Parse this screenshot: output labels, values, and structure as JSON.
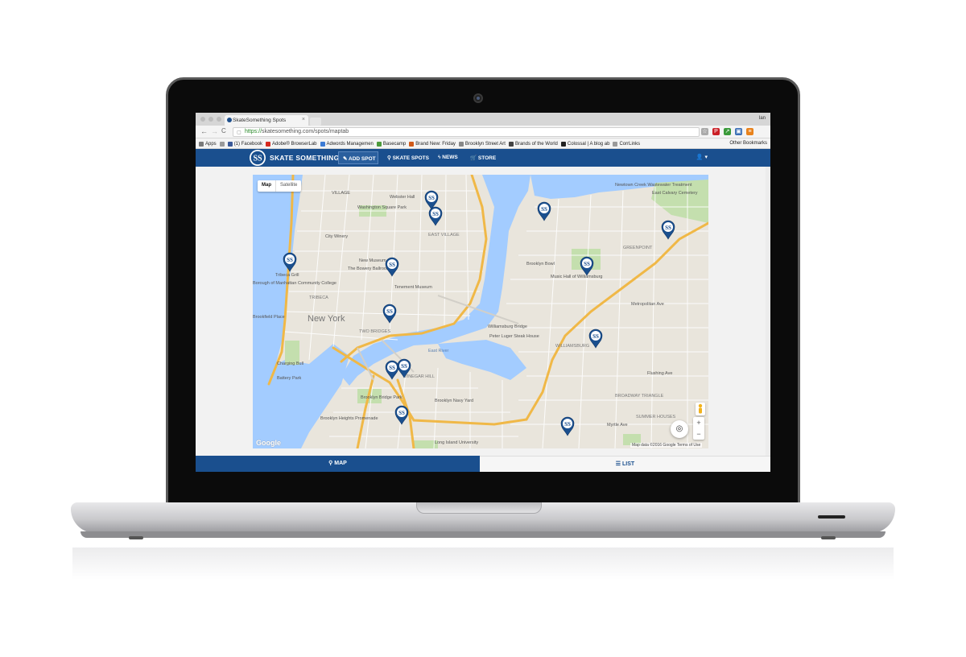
{
  "browser": {
    "tab_title": "SkateSomething Spots",
    "tab_close": "×",
    "user": "Ian",
    "url_scheme": "https://",
    "url_rest": "skatesomething.com/spots/maptab",
    "back": "←",
    "forward": "→",
    "reload": "C",
    "bookmarks": [
      {
        "label": "Apps",
        "color": "#7a7a7a"
      },
      {
        "label": "",
        "color": "#9a9a9a"
      },
      {
        "label": "(1) Facebook",
        "color": "#3b5998"
      },
      {
        "label": "Adobe® BrowserLab",
        "color": "#d62a1e"
      },
      {
        "label": "Adwords Managemen",
        "color": "#3c7bd4"
      },
      {
        "label": "Basecamp",
        "color": "#4c9a3c"
      },
      {
        "label": "Brand New: Friday",
        "color": "#d05a1a"
      },
      {
        "label": "Brooklyn Street Art",
        "color": "#888888"
      },
      {
        "label": "Brands of the World",
        "color": "#444444"
      },
      {
        "label": "Colossal | A blog ab",
        "color": "#222222"
      },
      {
        "label": "CorrLinks",
        "color": "#9a9a9a"
      }
    ],
    "other_bookmarks": "Other Bookmarks"
  },
  "site": {
    "logo_monogram": "SS",
    "logo_text": "SKATE SOMETHING",
    "add_spot": "✎ ADD SPOT",
    "nav": [
      {
        "label": "⚲ SKATE SPOTS"
      },
      {
        "label": "ϟ NEWS"
      },
      {
        "label": "🛒 STORE"
      }
    ],
    "user_menu": "👤 ▾"
  },
  "map": {
    "toggle_map": "Map",
    "toggle_satellite": "Satellite",
    "zoom_in": "+",
    "zoom_out": "−",
    "locate": "◎",
    "google": "Google",
    "attribution": "Map data ©2016 Google    Terms of Use",
    "labels": {
      "village": "VILLAGE",
      "webster": "Webster Hall",
      "washington": "Washington Square Park",
      "east_village": "EAST VILLAGE",
      "city_winery": "City Winery",
      "new_museum": "New Museum",
      "bowery": "The Bowery Ballroom",
      "tenement": "Tenement Museum",
      "tribeca_grill": "Tribeca Grill",
      "bmcc": "Borough of Manhattan Community College",
      "tribeca": "TRIBECA",
      "new_york": "New York",
      "two_bridges": "TWO BRIDGES",
      "brookfield": "Brookfield Place",
      "charging_bull": "Charging Bull",
      "battery": "Battery Park",
      "brooklyn_bridge_park": "Brooklyn Bridge Park",
      "heights": "Brooklyn Heights Promenade",
      "vinegar_hill": "VINEGAR HILL",
      "navy_yard": "Brooklyn Navy Yard",
      "liu": "Long Island University",
      "east_river": "East River",
      "williamsburg": "WILLIAMSBURG",
      "greenpoint": "GREENPOINT",
      "brooklyn_bowl": "Brooklyn Bowl",
      "music_hall": "Music Hall of Williamsburg",
      "peter_luger": "Peter Luger Steak House",
      "newtown": "Newtown Creek Wastewater Treatment",
      "calvary": "East Calvary Cemetery",
      "broadway_triangle": "BROADWAY TRIANGLE",
      "summer_houses": "SUMMER HOUSES",
      "metropolitan": "Metropolitan Ave",
      "flushing": "Flushing Ave",
      "myrtle": "Myrtle Ave",
      "williamsburg_bridge": "Williamsburg Bridge"
    },
    "pin_monogram": "SS"
  },
  "tabs": {
    "map": "⚲  MAP",
    "list": "☰  LIST"
  },
  "colors": {
    "brand_blue": "#1a4f8e",
    "water": "#a3ccff",
    "land": "#e9e5dc",
    "park": "#c4dfae",
    "highway": "#f0b847"
  }
}
